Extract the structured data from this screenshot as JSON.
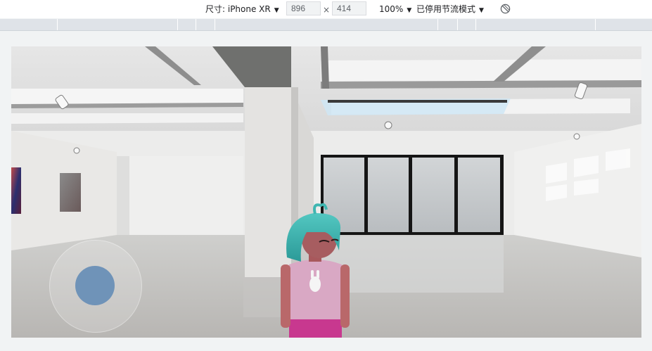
{
  "toolbar": {
    "dimensions_label": "尺寸: iPhone XR",
    "width_value": "896",
    "times": "×",
    "height_value": "414",
    "zoom": "100%",
    "throttling": "已停用节流模式",
    "rotate_icon": "rotate-icon"
  },
  "scene": {
    "description_icons": [
      "joystick-icon"
    ],
    "joystick_color": "#6f93b8"
  }
}
